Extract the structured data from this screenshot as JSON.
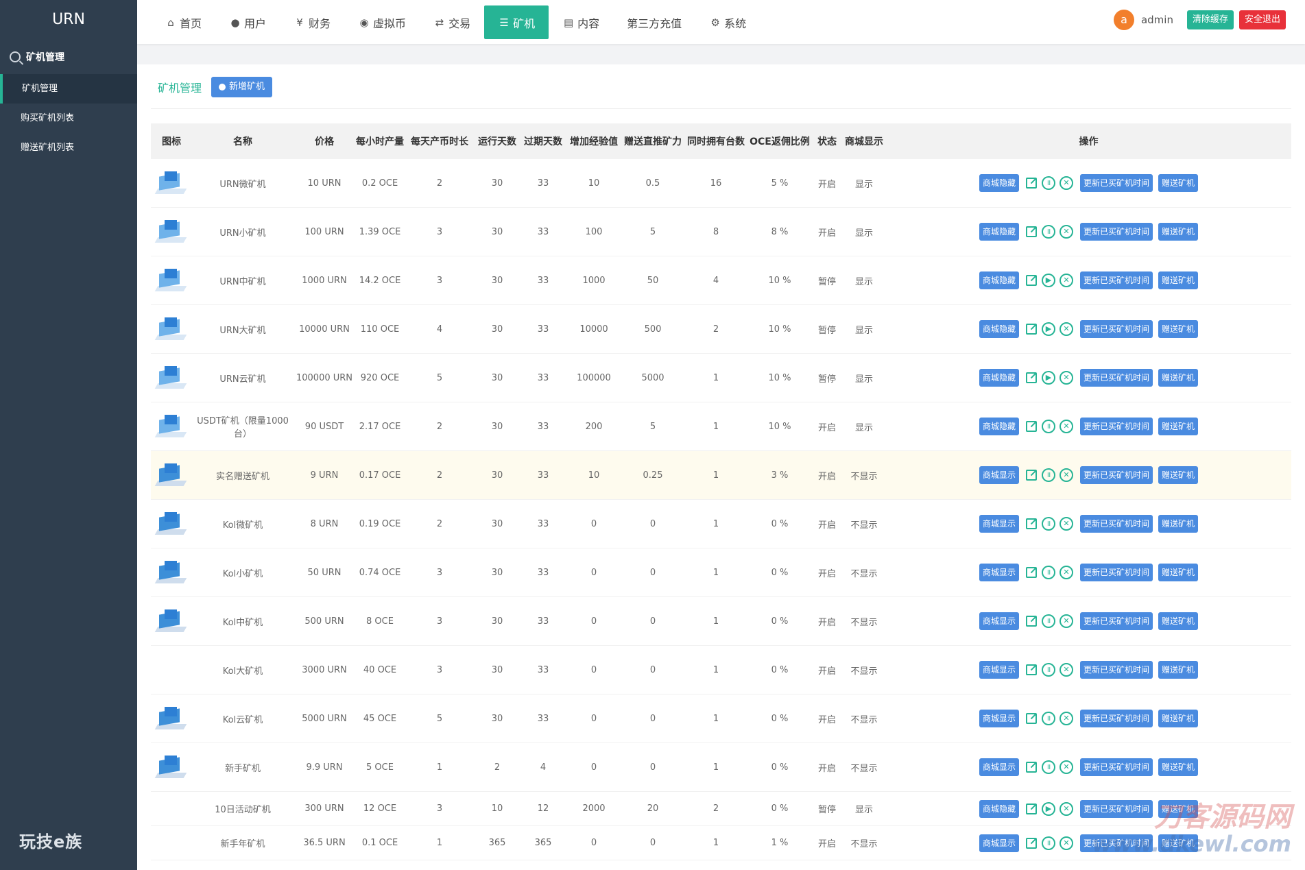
{
  "sidebar": {
    "brand": "URN",
    "section": "矿机管理",
    "items": [
      {
        "label": "矿机管理",
        "active": true
      },
      {
        "label": "购买矿机列表",
        "active": false
      },
      {
        "label": "赠送矿机列表",
        "active": false
      }
    ],
    "footer": "玩技e族"
  },
  "nav": [
    {
      "label": "首页",
      "icon": "home-icon"
    },
    {
      "label": "用户",
      "icon": "user-icon"
    },
    {
      "label": "财务",
      "icon": "yen-icon"
    },
    {
      "label": "虚拟币",
      "icon": "coins-icon"
    },
    {
      "label": "交易",
      "icon": "exchange-icon"
    },
    {
      "label": "矿机",
      "icon": "server-icon",
      "active": true
    },
    {
      "label": "内容",
      "icon": "document-icon"
    },
    {
      "label": "第三方充值",
      "icon": ""
    },
    {
      "label": "系统",
      "icon": "gear-icon"
    }
  ],
  "user": {
    "avatar_letter": "a",
    "name": "admin",
    "clear_cache": "清除缓存",
    "logout": "安全退出"
  },
  "page": {
    "title": "矿机管理",
    "add_button": "新增矿机"
  },
  "table": {
    "headers": [
      "图标",
      "名称",
      "价格",
      "每小时产量",
      "每天产币时长",
      "运行天数",
      "过期天数",
      "增加经验值",
      "赠送直推矿力",
      "同时拥有台数",
      "OCE返佣比例",
      "状态",
      "商城显示",
      "操作"
    ],
    "action_labels": {
      "update": "更新已买矿机时间",
      "gift": "赠送矿机"
    },
    "rows": [
      {
        "img": "t1",
        "name": "URN微矿机",
        "price": "10 URN",
        "hourly": "0.2 OCE",
        "daily_hours": "2",
        "run_days": "30",
        "expire_days": "33",
        "exp": "10",
        "direct_power": "0.5",
        "max_own": "16",
        "rebate": "5 %",
        "status": "开启",
        "shop": "显示",
        "shop_btn": "商城隐藏",
        "toggle": "pause"
      },
      {
        "img": "t1",
        "name": "URN小矿机",
        "price": "100 URN",
        "hourly": "1.39 OCE",
        "daily_hours": "3",
        "run_days": "30",
        "expire_days": "33",
        "exp": "100",
        "direct_power": "5",
        "max_own": "8",
        "rebate": "8 %",
        "status": "开启",
        "shop": "显示",
        "shop_btn": "商城隐藏",
        "toggle": "pause"
      },
      {
        "img": "t1",
        "name": "URN中矿机",
        "price": "1000 URN",
        "hourly": "14.2 OCE",
        "daily_hours": "3",
        "run_days": "30",
        "expire_days": "33",
        "exp": "1000",
        "direct_power": "50",
        "max_own": "4",
        "rebate": "10 %",
        "status": "暂停",
        "shop": "显示",
        "shop_btn": "商城隐藏",
        "toggle": "play"
      },
      {
        "img": "t1",
        "name": "URN大矿机",
        "price": "10000 URN",
        "hourly": "110 OCE",
        "daily_hours": "4",
        "run_days": "30",
        "expire_days": "33",
        "exp": "10000",
        "direct_power": "500",
        "max_own": "2",
        "rebate": "10 %",
        "status": "暂停",
        "shop": "显示",
        "shop_btn": "商城隐藏",
        "toggle": "play"
      },
      {
        "img": "t1",
        "name": "URN云矿机",
        "price": "100000 URN",
        "hourly": "920 OCE",
        "daily_hours": "5",
        "run_days": "30",
        "expire_days": "33",
        "exp": "100000",
        "direct_power": "5000",
        "max_own": "1",
        "rebate": "10 %",
        "status": "暂停",
        "shop": "显示",
        "shop_btn": "商城隐藏",
        "toggle": "play"
      },
      {
        "img": "t1",
        "name": "USDT矿机（限量1000台）",
        "price": "90 USDT",
        "hourly": "2.17 OCE",
        "daily_hours": "2",
        "run_days": "30",
        "expire_days": "33",
        "exp": "200",
        "direct_power": "5",
        "max_own": "1",
        "rebate": "10 %",
        "status": "开启",
        "shop": "显示",
        "shop_btn": "商城隐藏",
        "toggle": "pause"
      },
      {
        "img": "t2",
        "name": "实名赠送矿机",
        "price": "9 URN",
        "hourly": "0.17 OCE",
        "daily_hours": "2",
        "run_days": "30",
        "expire_days": "33",
        "exp": "10",
        "direct_power": "0.25",
        "max_own": "1",
        "rebate": "3 %",
        "status": "开启",
        "shop": "不显示",
        "shop_btn": "商城显示",
        "toggle": "pause",
        "highlight": true
      },
      {
        "img": "t2",
        "name": "Kol微矿机",
        "price": "8 URN",
        "hourly": "0.19 OCE",
        "daily_hours": "2",
        "run_days": "30",
        "expire_days": "33",
        "exp": "0",
        "direct_power": "0",
        "max_own": "1",
        "rebate": "0 %",
        "status": "开启",
        "shop": "不显示",
        "shop_btn": "商城显示",
        "toggle": "pause"
      },
      {
        "img": "t2",
        "name": "Kol小矿机",
        "price": "50 URN",
        "hourly": "0.74 OCE",
        "daily_hours": "3",
        "run_days": "30",
        "expire_days": "33",
        "exp": "0",
        "direct_power": "0",
        "max_own": "1",
        "rebate": "0 %",
        "status": "开启",
        "shop": "不显示",
        "shop_btn": "商城显示",
        "toggle": "pause"
      },
      {
        "img": "t2",
        "name": "Kol中矿机",
        "price": "500 URN",
        "hourly": "8 OCE",
        "daily_hours": "3",
        "run_days": "30",
        "expire_days": "33",
        "exp": "0",
        "direct_power": "0",
        "max_own": "1",
        "rebate": "0 %",
        "status": "开启",
        "shop": "不显示",
        "shop_btn": "商城显示",
        "toggle": "pause"
      },
      {
        "img": "",
        "name": "Kol大矿机",
        "price": "3000 URN",
        "hourly": "40 OCE",
        "daily_hours": "3",
        "run_days": "30",
        "expire_days": "33",
        "exp": "0",
        "direct_power": "0",
        "max_own": "1",
        "rebate": "0 %",
        "status": "开启",
        "shop": "不显示",
        "shop_btn": "商城显示",
        "toggle": "pause"
      },
      {
        "img": "t2",
        "name": "Kol云矿机",
        "price": "5000 URN",
        "hourly": "45 OCE",
        "daily_hours": "5",
        "run_days": "30",
        "expire_days": "33",
        "exp": "0",
        "direct_power": "0",
        "max_own": "1",
        "rebate": "0 %",
        "status": "开启",
        "shop": "不显示",
        "shop_btn": "商城显示",
        "toggle": "pause"
      },
      {
        "img": "t2",
        "name": "新手矿机",
        "price": "9.9 URN",
        "hourly": "5 OCE",
        "daily_hours": "1",
        "run_days": "2",
        "expire_days": "4",
        "exp": "0",
        "direct_power": "0",
        "max_own": "1",
        "rebate": "0 %",
        "status": "开启",
        "shop": "不显示",
        "shop_btn": "商城显示",
        "toggle": "pause"
      },
      {
        "img": "",
        "name": "10日活动矿机",
        "price": "300 URN",
        "hourly": "12 OCE",
        "daily_hours": "3",
        "run_days": "10",
        "expire_days": "12",
        "exp": "2000",
        "direct_power": "20",
        "max_own": "2",
        "rebate": "0 %",
        "status": "暂停",
        "shop": "显示",
        "shop_btn": "商城隐藏",
        "toggle": "play",
        "short": true
      },
      {
        "img": "",
        "name": "新手年矿机",
        "price": "36.5 URN",
        "hourly": "0.1 OCE",
        "daily_hours": "1",
        "run_days": "365",
        "expire_days": "365",
        "exp": "0",
        "direct_power": "0",
        "max_own": "1",
        "rebate": "1 %",
        "status": "开启",
        "shop": "不显示",
        "shop_btn": "商城显示",
        "toggle": "pause",
        "short": true
      }
    ]
  },
  "watermark": {
    "line1": "刀客源码网",
    "line2": "www.dkewl.com"
  }
}
